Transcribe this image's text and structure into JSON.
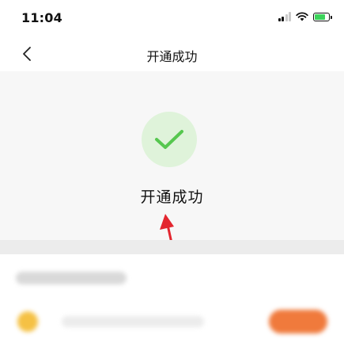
{
  "status_bar": {
    "time": "11:04",
    "icons": [
      "signal-icon",
      "wifi-icon",
      "battery-charging-icon"
    ],
    "battery_color": "#3bd35a"
  },
  "nav": {
    "title": "开通成功",
    "back_icon": "chevron-left-icon"
  },
  "result": {
    "icon": "checkmark-icon",
    "icon_color": "#56c74f",
    "icon_bg": "#dff3da",
    "message": "开通成功"
  },
  "annotation": {
    "icon": "red-arrow-icon",
    "color": "#e3262f"
  }
}
